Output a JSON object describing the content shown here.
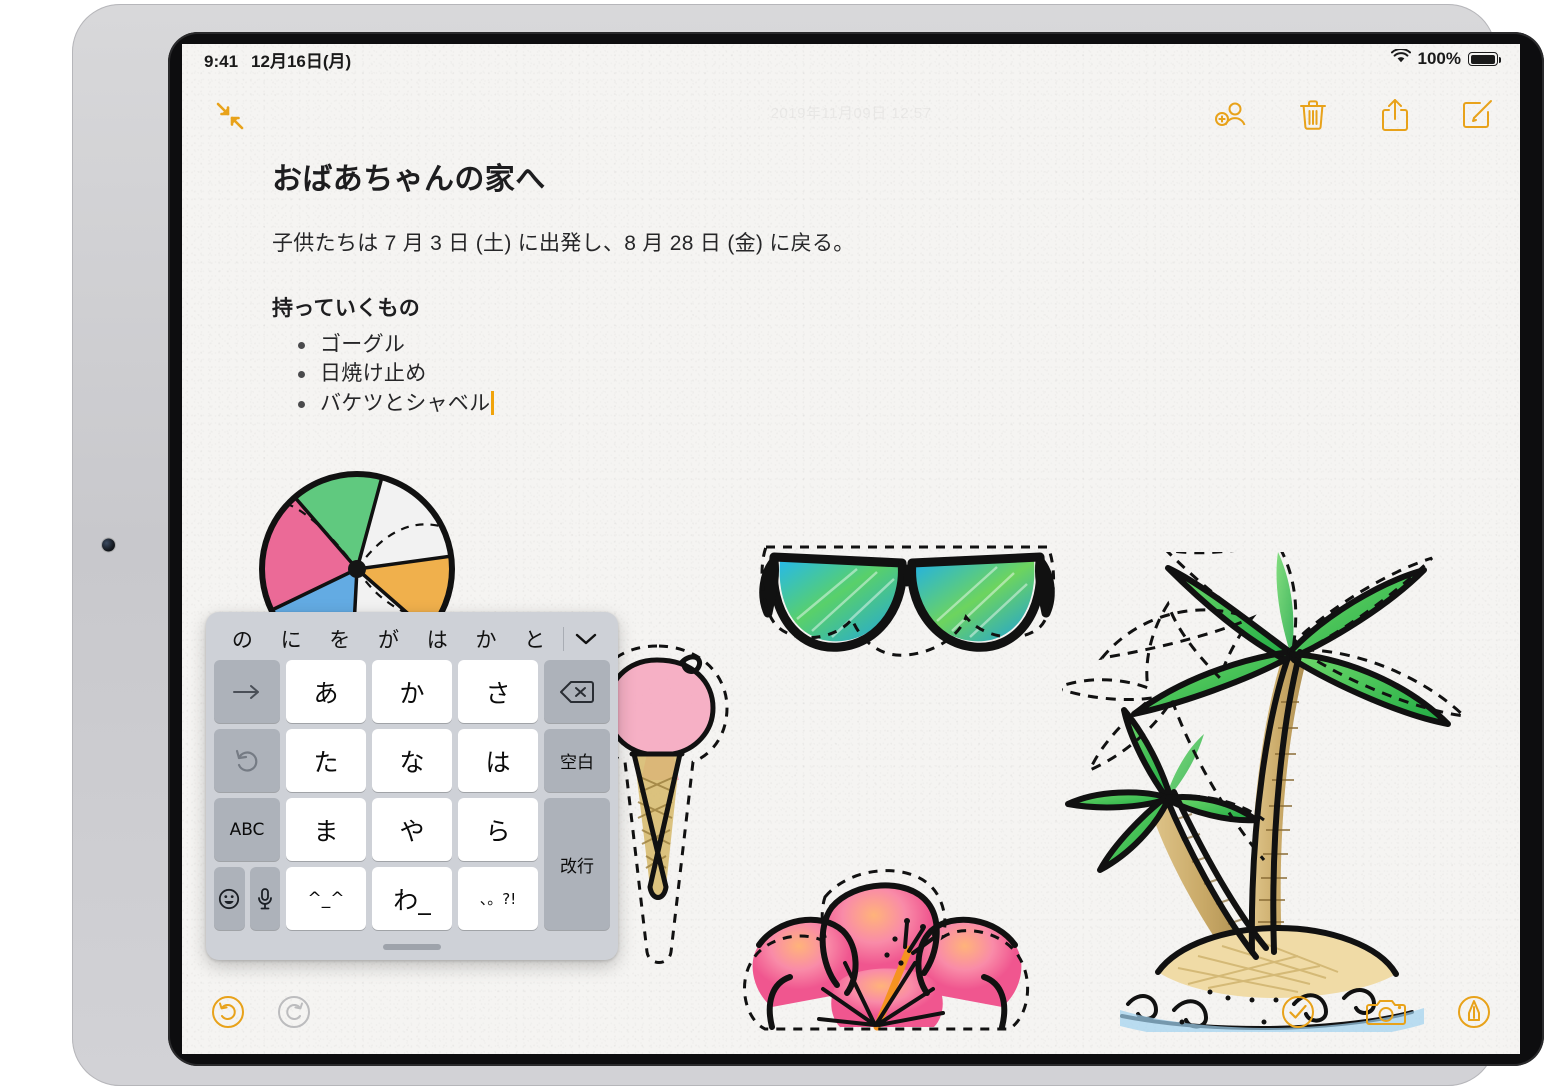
{
  "device": {
    "name": "iPad"
  },
  "status_bar": {
    "time": "9:41",
    "date": "12月16日(月)",
    "wifi_icon": "wifi-icon",
    "battery_percent": "100%",
    "battery_icon": "battery-full-icon"
  },
  "note_toolbar": {
    "collapse_icon": "collapse-arrows-icon",
    "timestamp": "2019年11月09日 12:57",
    "actions": [
      {
        "name": "add-person-button",
        "icon": "person-add-icon"
      },
      {
        "name": "delete-button",
        "icon": "trash-icon"
      },
      {
        "name": "share-button",
        "icon": "share-icon"
      },
      {
        "name": "compose-button",
        "icon": "compose-icon"
      }
    ]
  },
  "note": {
    "title": "おばあちゃんの家へ",
    "paragraph": "子供たちは 7 月 3 日 (土) に出発し、8 月 28 日 (金) に戻る。",
    "checklist_heading": "持っていくもの",
    "bullets": [
      {
        "text": "ゴーグル",
        "has_caret": false
      },
      {
        "text": "日焼け止め",
        "has_caret": false
      },
      {
        "text": "バケツとシャベル",
        "has_caret": true
      }
    ]
  },
  "drawings": [
    {
      "name": "beach-ball-sticker",
      "label": "ビーチボール"
    },
    {
      "name": "ice-cream-sticker",
      "label": "アイスクリーム"
    },
    {
      "name": "sunglasses-sticker",
      "label": "サングラス"
    },
    {
      "name": "hibiscus-flower-sticker",
      "label": "ハイビスカス"
    },
    {
      "name": "palm-tree-island-sticker",
      "label": "ヤシの木の島"
    }
  ],
  "keyboard": {
    "type": "japanese-kana-floating",
    "predictions": [
      "の",
      "に",
      "を",
      "が",
      "は",
      "か",
      "と"
    ],
    "collapse_icon": "chevron-down-icon",
    "rows": [
      [
        {
          "label": "→",
          "name": "key-arrow-right",
          "style": "dark"
        },
        {
          "label": "あ",
          "name": "key-a",
          "style": "light"
        },
        {
          "label": "か",
          "name": "key-ka",
          "style": "light"
        },
        {
          "label": "さ",
          "name": "key-sa",
          "style": "light"
        },
        {
          "label": "⌫",
          "name": "key-delete",
          "style": "dark",
          "icon": "delete-backward-icon"
        }
      ],
      [
        {
          "label": "↺",
          "name": "key-undo",
          "style": "dark",
          "icon": "undo-arrow-icon"
        },
        {
          "label": "た",
          "name": "key-ta",
          "style": "light"
        },
        {
          "label": "な",
          "name": "key-na",
          "style": "light"
        },
        {
          "label": "は",
          "name": "key-ha",
          "style": "light"
        },
        {
          "label": "空白",
          "name": "key-space",
          "style": "dark"
        }
      ],
      [
        {
          "label": "ABC",
          "name": "key-abc",
          "style": "dark"
        },
        {
          "label": "ま",
          "name": "key-ma",
          "style": "light"
        },
        {
          "label": "や",
          "name": "key-ya",
          "style": "light"
        },
        {
          "label": "ら",
          "name": "key-ra",
          "style": "light"
        },
        {
          "label": "改行",
          "name": "key-return",
          "style": "dark"
        }
      ],
      [
        {
          "label": "☺",
          "name": "key-emoji",
          "style": "dark",
          "icon": "smiley-icon"
        },
        {
          "label": "🎤",
          "name": "key-dictation",
          "style": "dark",
          "icon": "microphone-icon"
        },
        {
          "label": "^_^",
          "name": "key-kaomoji",
          "style": "light"
        },
        {
          "label": "わ_",
          "name": "key-wa",
          "style": "light"
        },
        {
          "label": "、。?!",
          "name": "key-punctuation",
          "style": "light"
        }
      ]
    ],
    "handle": "keyboard-drag-handle"
  },
  "bottom_toolbar": {
    "left": [
      {
        "name": "undo-button",
        "icon": "undo-circle-icon",
        "state": "enabled"
      },
      {
        "name": "redo-button",
        "icon": "redo-circle-icon",
        "state": "disabled"
      }
    ],
    "right": [
      {
        "name": "checklist-button",
        "icon": "checkmark-circle-icon"
      },
      {
        "name": "camera-button",
        "icon": "camera-icon"
      },
      {
        "name": "markup-button",
        "icon": "markup-pen-icon"
      }
    ]
  },
  "colors": {
    "accent": "#e8a21a",
    "disabled": "#b9b9bb",
    "paper": "#f5f4f2",
    "keyboard_bg": "#ced1d7",
    "key_light": "#ffffff",
    "key_dark": "#adb2ba",
    "caret": "#f0a30a"
  }
}
